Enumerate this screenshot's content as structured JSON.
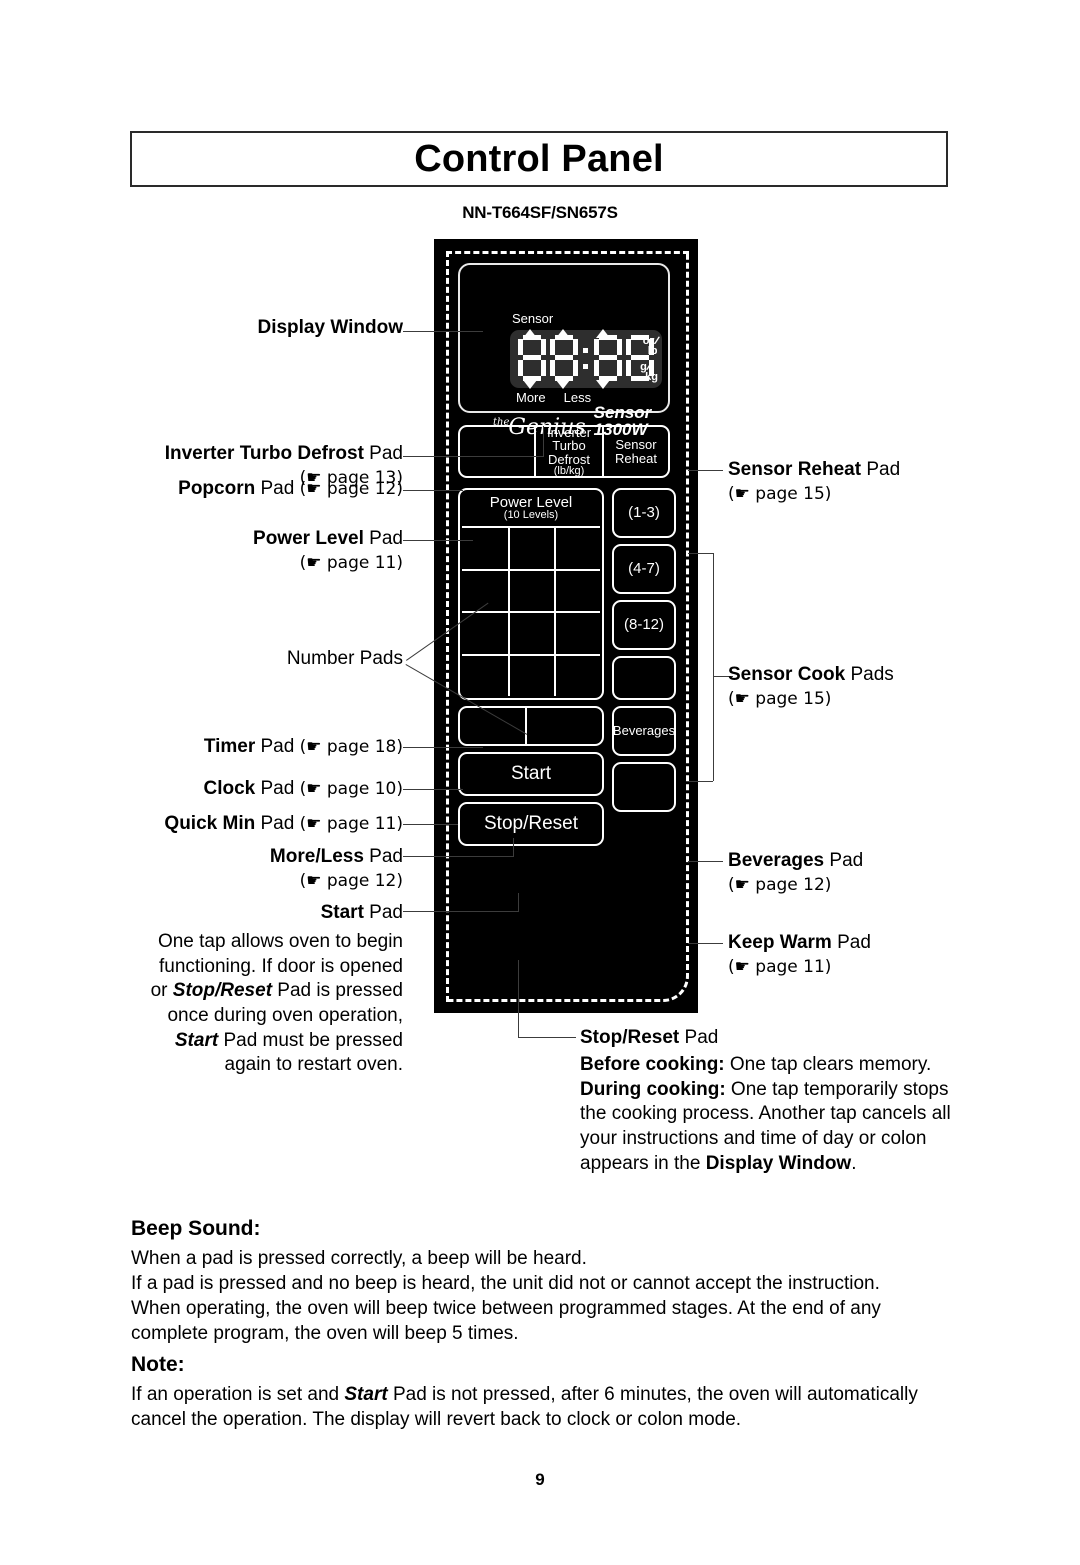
{
  "page": {
    "title": "Control Panel",
    "model": "NN-T664SF/SN657S",
    "page_number": "9"
  },
  "panel": {
    "display": {
      "sensor_label": "Sensor",
      "digits": "88:88",
      "more_label": "More",
      "less_label": "Less",
      "unit_oz_num": "oz",
      "unit_oz_den": "lb",
      "unit_g_num": "g",
      "unit_g_den": "kg",
      "brand_the": "the",
      "brand_genius": "Genius",
      "brand_sensor": "Sensor 1300W"
    },
    "pads": {
      "popcorn": "",
      "inverter_turbo_defrost": "Inverter\nTurbo\nDefrost",
      "inverter_turbo_defrost_l1": "Inverter",
      "inverter_turbo_defrost_l2": "Turbo",
      "inverter_turbo_defrost_l3": "Defrost",
      "inverter_turbo_defrost_sub": "(lb/kg)",
      "sensor_reheat_l1": "Sensor",
      "sensor_reheat_l2": "Reheat",
      "power_level_title": "Power Level",
      "power_level_sub": "(10 Levels)",
      "sensor_cook_1": "(1-3)",
      "sensor_cook_2": "(4-7)",
      "sensor_cook_3": "(8-12)",
      "sensor_cook_4": "",
      "beverages": "Beverages",
      "keep_warm": "",
      "timer": "",
      "clock": "",
      "quick_min": "",
      "start": "Start",
      "stop_reset": "Stop/Reset"
    }
  },
  "callouts": {
    "display_window": {
      "bold": "Display Window",
      "rest": ""
    },
    "inverter_turbo_defrost": {
      "bold": "Inverter Turbo Defrost",
      "rest": " Pad",
      "ref": "(☛ page 13)"
    },
    "popcorn": {
      "bold": "Popcorn",
      "rest": " Pad ",
      "ref": "(☛ page 12)"
    },
    "power_level": {
      "bold": "Power Level",
      "rest": " Pad",
      "ref": "(☛ page 11)"
    },
    "number_pads": {
      "bold": "",
      "rest": "Number Pads"
    },
    "timer": {
      "bold": "Timer",
      "rest": " Pad ",
      "ref": "(☛ page 18)"
    },
    "clock": {
      "bold": "Clock",
      "rest": " Pad ",
      "ref": "(☛ page 10)"
    },
    "quick_min": {
      "bold": "Quick Min",
      "rest": " Pad ",
      "ref": "(☛ page 11)"
    },
    "more_less": {
      "bold": "More/Less",
      "rest": " Pad",
      "ref": "(☛ page 12)"
    },
    "start": {
      "bold": "Start",
      "rest": " Pad"
    },
    "sensor_reheat": {
      "bold": "Sensor Reheat",
      "rest": " Pad",
      "ref": "(☛ page 15)"
    },
    "sensor_cook": {
      "bold": "Sensor Cook",
      "rest": " Pads",
      "ref": "(☛ page 15)"
    },
    "beverages": {
      "bold": "Beverages",
      "rest": " Pad",
      "ref": "(☛ page 12)"
    },
    "keep_warm": {
      "bold": "Keep Warm",
      "rest": " Pad",
      "ref": "(☛ page 11)"
    },
    "stop_reset": {
      "bold": "Stop/Reset",
      "rest": " Pad"
    }
  },
  "start_description": {
    "line1": "One tap allows oven to begin",
    "line2_a": "functioning. If door is opened",
    "line3_a": "or ",
    "line3_bi": "Stop/Reset",
    "line3_b": " Pad is pressed",
    "line4": "once during oven operation,",
    "line5_bi": "Start",
    "line5_b": " Pad must be pressed",
    "line6": "again to restart oven."
  },
  "stop_description": {
    "before_label": "Before cooking:",
    "before_text": " One tap clears memory.",
    "during_label": "During cooking:",
    "during_text": " One tap temporarily stops the cooking process. Another tap cancels all your instructions and time of day or colon appears in the ",
    "display_window_bold": "Display Window",
    "period": "."
  },
  "beep_sound": {
    "heading": "Beep Sound:",
    "line1": "When a pad is pressed correctly, a beep will be heard.",
    "line2": "If a pad is pressed and no beep is heard, the unit did not or cannot accept the instruction.",
    "line3": "When operating, the oven will beep twice between programmed stages. At the end of any complete program, the oven will beep 5 times."
  },
  "note": {
    "heading": "Note:",
    "text_a": "If an operation is set and ",
    "text_bi": "Start",
    "text_b": " Pad is not pressed, after 6 minutes, the oven will automatically cancel the operation. The display will revert back to clock or colon mode."
  }
}
